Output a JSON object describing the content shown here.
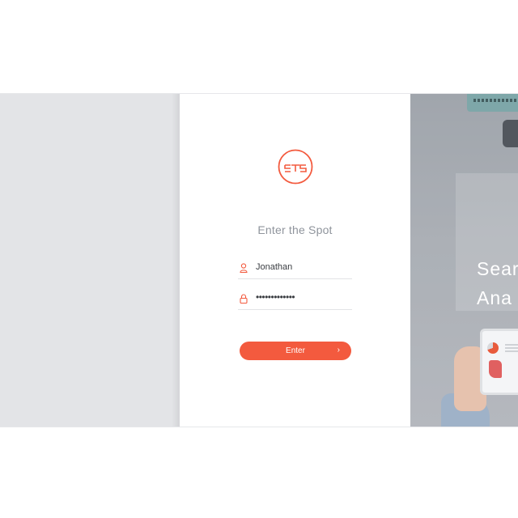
{
  "login": {
    "logo_text": "STS",
    "title": "Enter the Spot",
    "username": {
      "value": "Jonathan",
      "icon": "user-icon"
    },
    "password": {
      "value": "•••••••••••••",
      "icon": "lock-icon"
    },
    "submit": {
      "label": "Enter",
      "icon": "chevron-right-icon"
    }
  },
  "promo": {
    "line1": "Sear",
    "line2": "Ana"
  },
  "colors": {
    "accent": "#f35a3e",
    "left_panel": "#e3e4e7",
    "title_text": "#8f949c"
  }
}
